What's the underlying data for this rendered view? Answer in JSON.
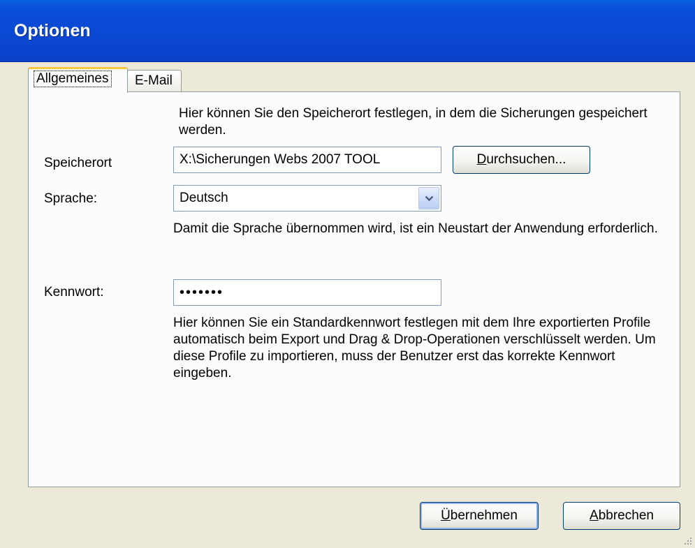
{
  "window": {
    "title": "Optionen"
  },
  "tabs": [
    {
      "label": "Allgemeines",
      "active": true
    },
    {
      "label": "E-Mail",
      "active": false
    }
  ],
  "general": {
    "intro": "Hier können Sie den Speicherort festlegen, in dem die Sicherungen gespeichert werden.",
    "location": {
      "label": "Speicherort",
      "value": "X:\\Sicherungen Webs 2007 TOOL",
      "browse_mnemonic": "D",
      "browse_rest": "urchsuchen..."
    },
    "language": {
      "label": "Sprache:",
      "value": "Deutsch",
      "note": "Damit die Sprache übernommen wird, ist ein Neustart der Anwendung erforderlich."
    },
    "password": {
      "label": "Kennwort:",
      "value": "•••••••",
      "note": "Hier können Sie ein Standardkennwort festlegen mit dem Ihre exportierten Profile automatisch beim Export und Drag & Drop-Operationen verschlüsselt werden. Um diese Profile zu importieren, muss der Benutzer erst das korrekte Kennwort eingeben."
    }
  },
  "footer": {
    "apply": {
      "mnemonic": "Ü",
      "rest": "bernehmen"
    },
    "cancel": {
      "mnemonic": "A",
      "rest": "bbrechen"
    }
  },
  "icons": {
    "dropdown": "chevron-down-icon",
    "resize": "resize-grip-icon"
  },
  "colors": {
    "titlebar": "#0a48d2",
    "dialog_bg": "#ece9d8",
    "panel_bg": "#fcfcfe",
    "tab_highlight": "#ffc83c",
    "input_border": "#7f9db9"
  }
}
